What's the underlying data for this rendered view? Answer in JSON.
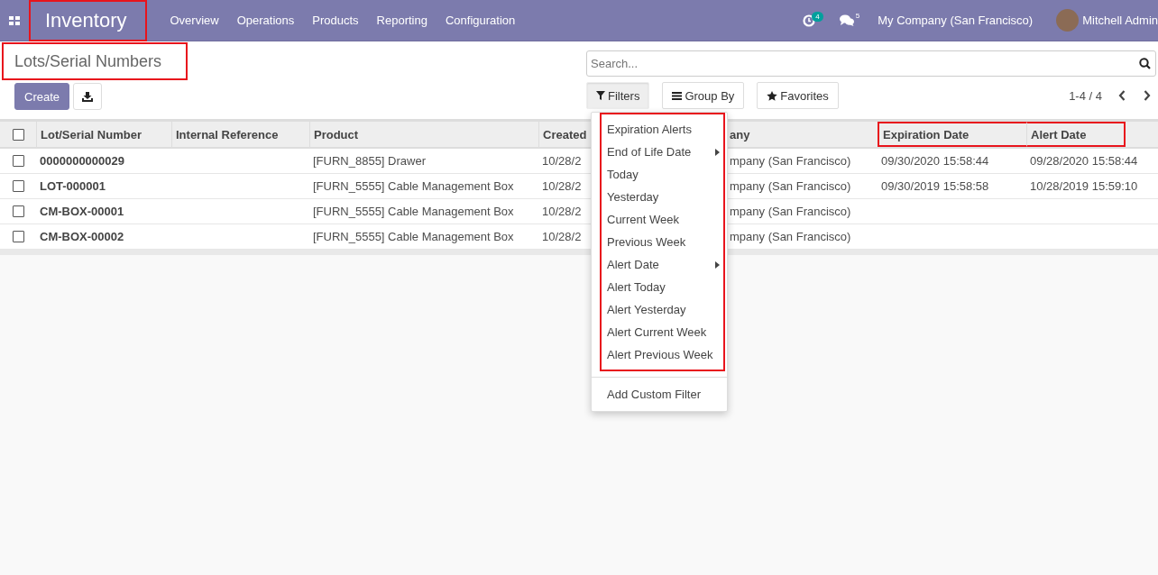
{
  "navbar": {
    "app_name": "Inventory",
    "app_highlighted": true,
    "menu": [
      "Overview",
      "Operations",
      "Products",
      "Reporting",
      "Configuration"
    ],
    "activity_count": "4",
    "message_count": "5",
    "company": "My Company (San Francisco)",
    "user": "Mitchell Admin"
  },
  "page": {
    "title": "Lots/Serial Numbers",
    "title_highlighted": true
  },
  "create_button": "Create",
  "search": {
    "placeholder": "Search..."
  },
  "search_buttons": [
    {
      "kind": "filter",
      "label": "Filters",
      "selected": true
    },
    {
      "kind": "group",
      "label": "Group By",
      "selected": false
    },
    {
      "kind": "star",
      "label": "Favorites",
      "selected": false
    }
  ],
  "pager": "1-4 / 4",
  "table": {
    "all_checked": false,
    "columns": [
      {
        "label": "Lot/Serial Number",
        "highlighted": false
      },
      {
        "label": "Internal Reference",
        "highlighted": false
      },
      {
        "label": "Product",
        "highlighted": false
      },
      {
        "label": "Created",
        "highlighted": false
      },
      {
        "label": "any",
        "highlighted": false
      },
      {
        "label": "Expiration Date",
        "highlighted": true
      },
      {
        "label": "Alert Date",
        "highlighted": true
      }
    ],
    "rows": [
      {
        "checked": false,
        "lot": "0000000000029",
        "product": "[FURN_8855] Drawer",
        "created": "10/28/2",
        "company": "mpany (San Francisco)",
        "expiration": "09/30/2020 15:58:44",
        "alert": "09/28/2020 15:58:44"
      },
      {
        "checked": false,
        "lot": "LOT-000001",
        "product": "[FURN_5555] Cable Management Box",
        "created": "10/28/2",
        "company": "mpany (San Francisco)",
        "expiration": "09/30/2019 15:58:58",
        "alert": "10/28/2019 15:59:10"
      },
      {
        "checked": false,
        "lot": "CM-BOX-00001",
        "product": "[FURN_5555] Cable Management Box",
        "created": "10/28/2",
        "company": "mpany (San Francisco)"
      },
      {
        "checked": false,
        "lot": "CM-BOX-00002",
        "product": "[FURN_5555] Cable Management Box",
        "created": "10/28/2",
        "company": "mpany (San Francisco)"
      }
    ]
  },
  "filters_menu": {
    "group_highlighted": true,
    "items": [
      {
        "label": "Expiration Alerts",
        "submenu": false
      },
      {
        "label": "End of Life Date",
        "submenu": true
      },
      {
        "label": "Today",
        "submenu": false
      },
      {
        "label": "Yesterday",
        "submenu": false
      },
      {
        "label": "Current Week",
        "submenu": false
      },
      {
        "label": "Previous Week",
        "submenu": false
      },
      {
        "label": "Alert Date",
        "submenu": true
      },
      {
        "label": "Alert Today",
        "submenu": false
      },
      {
        "label": "Alert Yesterday",
        "submenu": false
      },
      {
        "label": "Alert Current Week",
        "submenu": false
      },
      {
        "label": "Alert Previous Week",
        "submenu": false
      }
    ],
    "custom": "Add Custom Filter"
  }
}
